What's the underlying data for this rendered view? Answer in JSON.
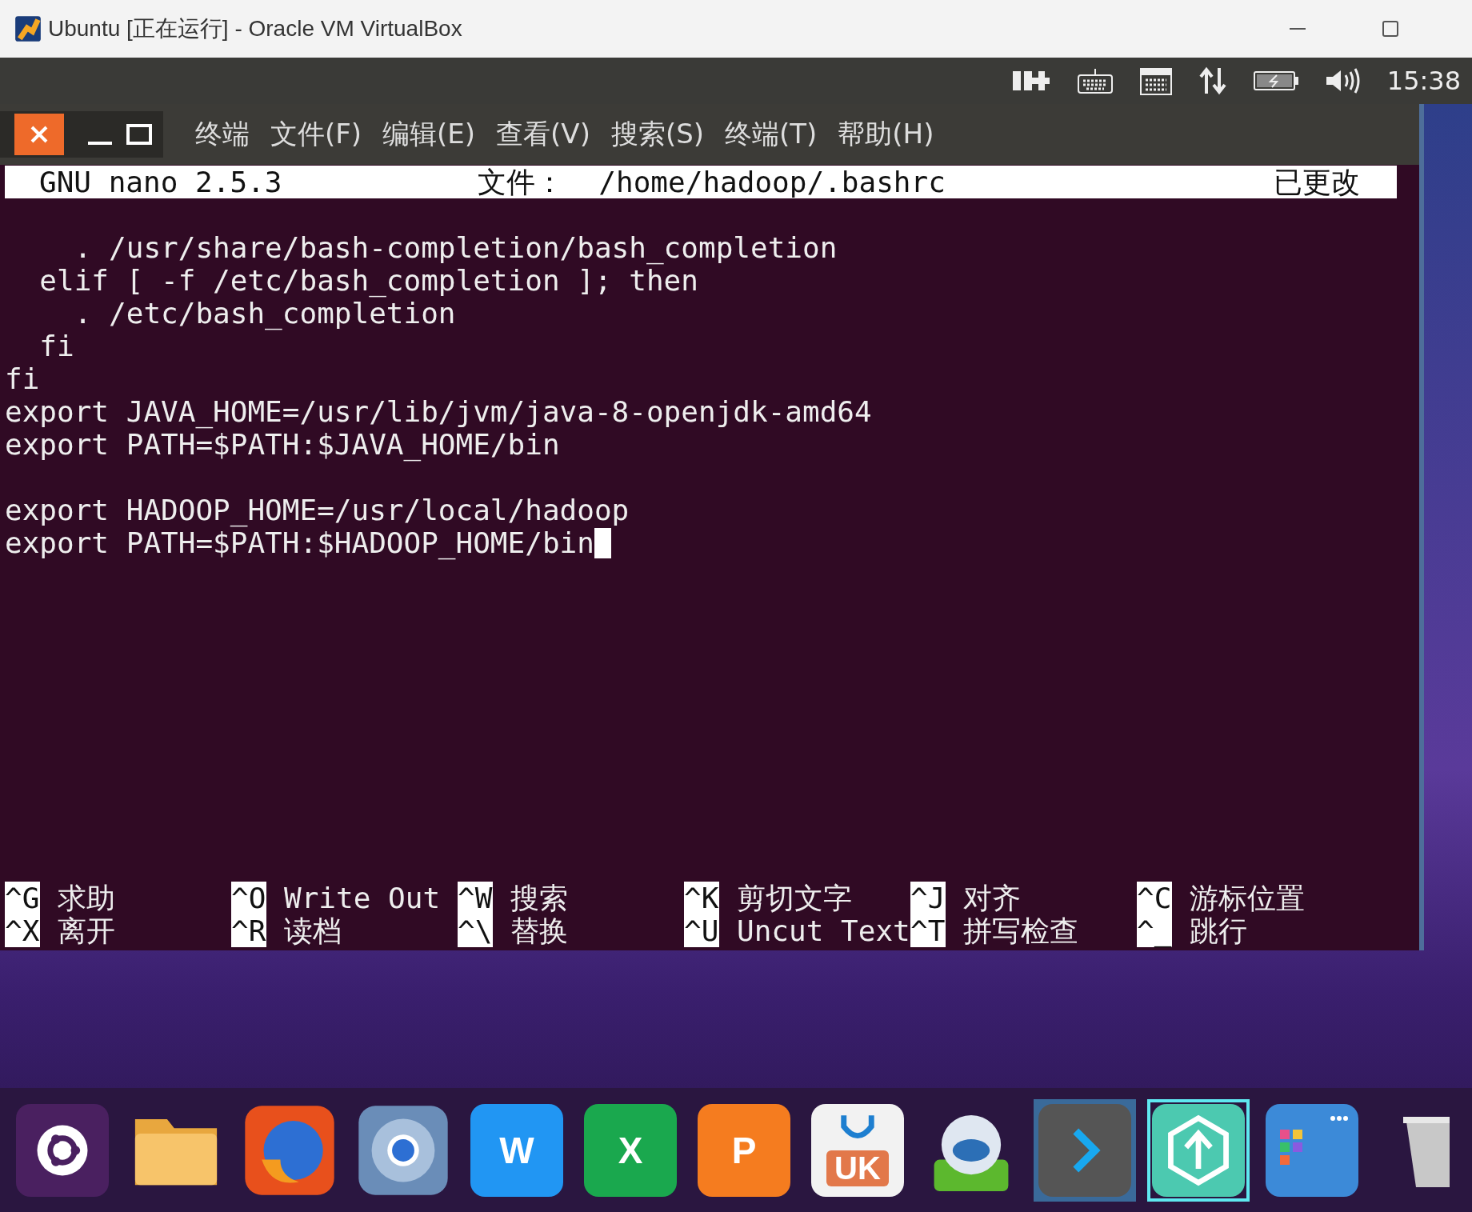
{
  "window": {
    "title": "Ubuntu [正在运行] - Oracle VM VirtualBox"
  },
  "top_panel": {
    "clock": "15:38"
  },
  "terminal": {
    "menu": [
      "终端",
      "文件(F)",
      "编辑(E)",
      "查看(V)",
      "搜索(S)",
      "终端(T)",
      "帮助(H)"
    ],
    "nano": {
      "version": "GNU nano 2.5.3",
      "file": "文件：  /home/hadoop/.bashrc",
      "status": "已更改",
      "blocks": [
        [
          "    . /usr/share/bash-completion/bash_completion",
          "  elif [ -f /etc/bash_completion ]; then",
          "    . /etc/bash_completion",
          "  fi",
          "fi",
          "export JAVA_HOME=/usr/lib/jvm/java-8-openjdk-amd64",
          "export PATH=$PATH:$JAVA_HOME/bin"
        ],
        [
          "export HADOOP_HOME=/usr/local/hadoop",
          "export PATH=$PATH:$HADOOP_HOME/bin"
        ]
      ],
      "shortcuts": [
        [
          {
            "key": "^G",
            "label": "求助"
          },
          {
            "key": "^X",
            "label": "离开"
          }
        ],
        [
          {
            "key": "^O",
            "label": "Write Out"
          },
          {
            "key": "^R",
            "label": "读档"
          }
        ],
        [
          {
            "key": "^W",
            "label": "搜索"
          },
          {
            "key": "^\\",
            "label": "替换"
          }
        ],
        [
          {
            "key": "^K",
            "label": "剪切文字"
          },
          {
            "key": "^U",
            "label": "Uncut Text"
          }
        ],
        [
          {
            "key": "^J",
            "label": "对齐"
          },
          {
            "key": "^T",
            "label": "拼写检查"
          }
        ],
        [
          {
            "key": "^C",
            "label": "游标位置"
          },
          {
            "key": "^_",
            "label": "跳行"
          }
        ]
      ]
    }
  },
  "dock": [
    {
      "kind": "ubuntu",
      "selected": false,
      "active": false
    },
    {
      "kind": "folder",
      "selected": false,
      "active": false
    },
    {
      "kind": "firefox",
      "selected": false,
      "active": false
    },
    {
      "kind": "browser",
      "selected": false,
      "active": false
    },
    {
      "kind": "word",
      "glyph": "W",
      "selected": false,
      "active": false
    },
    {
      "kind": "excel",
      "glyph": "X",
      "selected": false,
      "active": false
    },
    {
      "kind": "powerpoint",
      "glyph": "P",
      "selected": false,
      "active": false
    },
    {
      "kind": "bag",
      "glyph": "UK",
      "selected": false,
      "active": false
    },
    {
      "kind": "robot",
      "selected": false,
      "active": false
    },
    {
      "kind": "chevron",
      "selected": false,
      "active": true
    },
    {
      "kind": "hexagon",
      "selected": true,
      "active": false
    },
    {
      "kind": "window",
      "selected": false,
      "active": false
    },
    {
      "kind": "trash",
      "selected": false,
      "active": false
    }
  ]
}
